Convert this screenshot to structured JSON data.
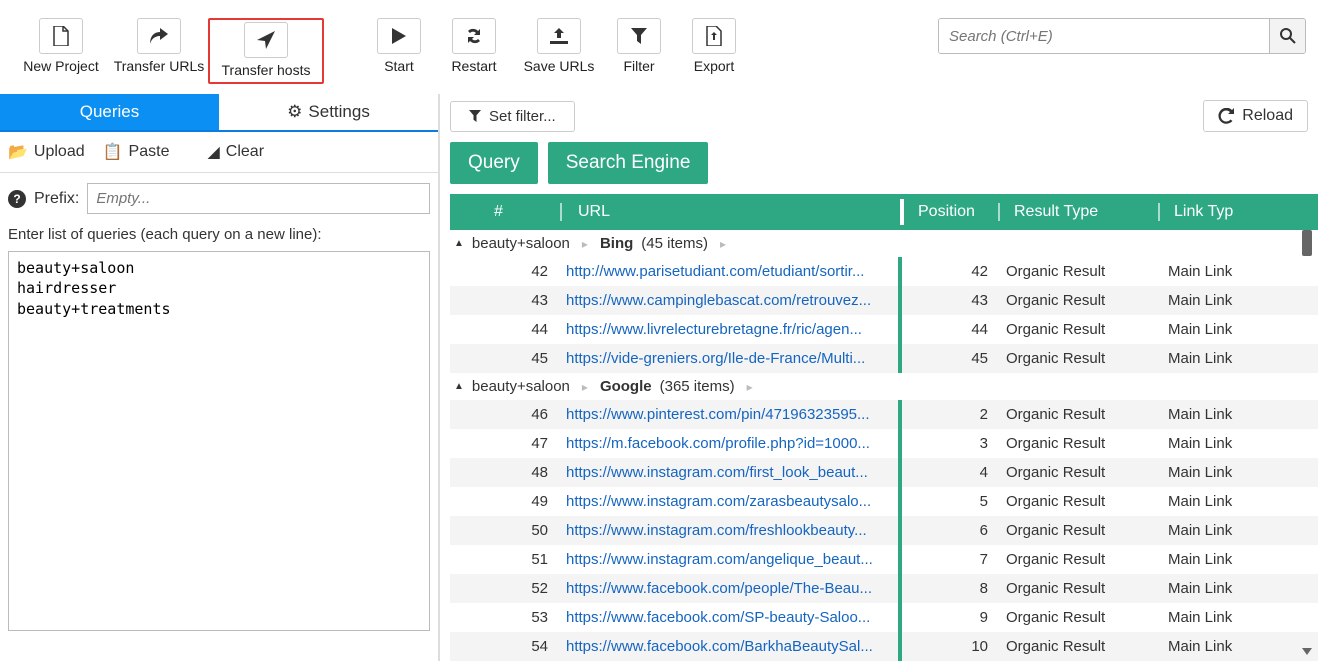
{
  "toolbar": {
    "new_project": "New Project",
    "transfer_urls": "Transfer URLs",
    "transfer_hosts": "Transfer hosts",
    "start": "Start",
    "restart": "Restart",
    "save_urls": "Save URLs",
    "filter": "Filter",
    "export": "Export",
    "search_placeholder": "Search (Ctrl+E)"
  },
  "tabs": {
    "queries": "Queries",
    "settings": "Settings"
  },
  "left": {
    "upload": "Upload",
    "paste": "Paste",
    "clear": "Clear",
    "prefix_label": "Prefix:",
    "prefix_placeholder": "Empty...",
    "hint": "Enter list of queries (each query on a new line):",
    "queries_text": "beauty+saloon\nhairdresser\nbeauty+treatments"
  },
  "right": {
    "set_filter": "Set filter...",
    "reload": "Reload",
    "badge_query": "Query",
    "badge_engine": "Search Engine",
    "head": {
      "num": "#",
      "url": "URL",
      "position": "Position",
      "result_type": "Result Type",
      "link_type": "Link Typ"
    }
  },
  "groups": [
    {
      "query": "beauty+saloon",
      "engine": "Bing",
      "count_label": "(45 items)",
      "rows": [
        {
          "n": 42,
          "url": "http://www.parisetudiant.com/etudiant/sortir...",
          "pos": 42,
          "rt": "Organic Result",
          "lt": "Main Link"
        },
        {
          "n": 43,
          "url": "https://www.campinglebascat.com/retrouvez...",
          "pos": 43,
          "rt": "Organic Result",
          "lt": "Main Link"
        },
        {
          "n": 44,
          "url": "https://www.livrelecturebretagne.fr/ric/agen...",
          "pos": 44,
          "rt": "Organic Result",
          "lt": "Main Link"
        },
        {
          "n": 45,
          "url": "https://vide-greniers.org/Ile-de-France/Multi...",
          "pos": 45,
          "rt": "Organic Result",
          "lt": "Main Link"
        }
      ]
    },
    {
      "query": "beauty+saloon",
      "engine": "Google",
      "count_label": "(365 items)",
      "rows": [
        {
          "n": 46,
          "url": "https://www.pinterest.com/pin/47196323595...",
          "pos": 2,
          "rt": "Organic Result",
          "lt": "Main Link"
        },
        {
          "n": 47,
          "url": "https://m.facebook.com/profile.php?id=1000...",
          "pos": 3,
          "rt": "Organic Result",
          "lt": "Main Link"
        },
        {
          "n": 48,
          "url": "https://www.instagram.com/first_look_beaut...",
          "pos": 4,
          "rt": "Organic Result",
          "lt": "Main Link"
        },
        {
          "n": 49,
          "url": "https://www.instagram.com/zarasbeautysalo...",
          "pos": 5,
          "rt": "Organic Result",
          "lt": "Main Link"
        },
        {
          "n": 50,
          "url": "https://www.instagram.com/freshlookbeauty...",
          "pos": 6,
          "rt": "Organic Result",
          "lt": "Main Link"
        },
        {
          "n": 51,
          "url": "https://www.instagram.com/angelique_beaut...",
          "pos": 7,
          "rt": "Organic Result",
          "lt": "Main Link"
        },
        {
          "n": 52,
          "url": "https://www.facebook.com/people/The-Beau...",
          "pos": 8,
          "rt": "Organic Result",
          "lt": "Main Link"
        },
        {
          "n": 53,
          "url": "https://www.facebook.com/SP-beauty-Saloo...",
          "pos": 9,
          "rt": "Organic Result",
          "lt": "Main Link"
        },
        {
          "n": 54,
          "url": "https://www.facebook.com/BarkhaBeautySal...",
          "pos": 10,
          "rt": "Organic Result",
          "lt": "Main Link"
        }
      ]
    }
  ]
}
